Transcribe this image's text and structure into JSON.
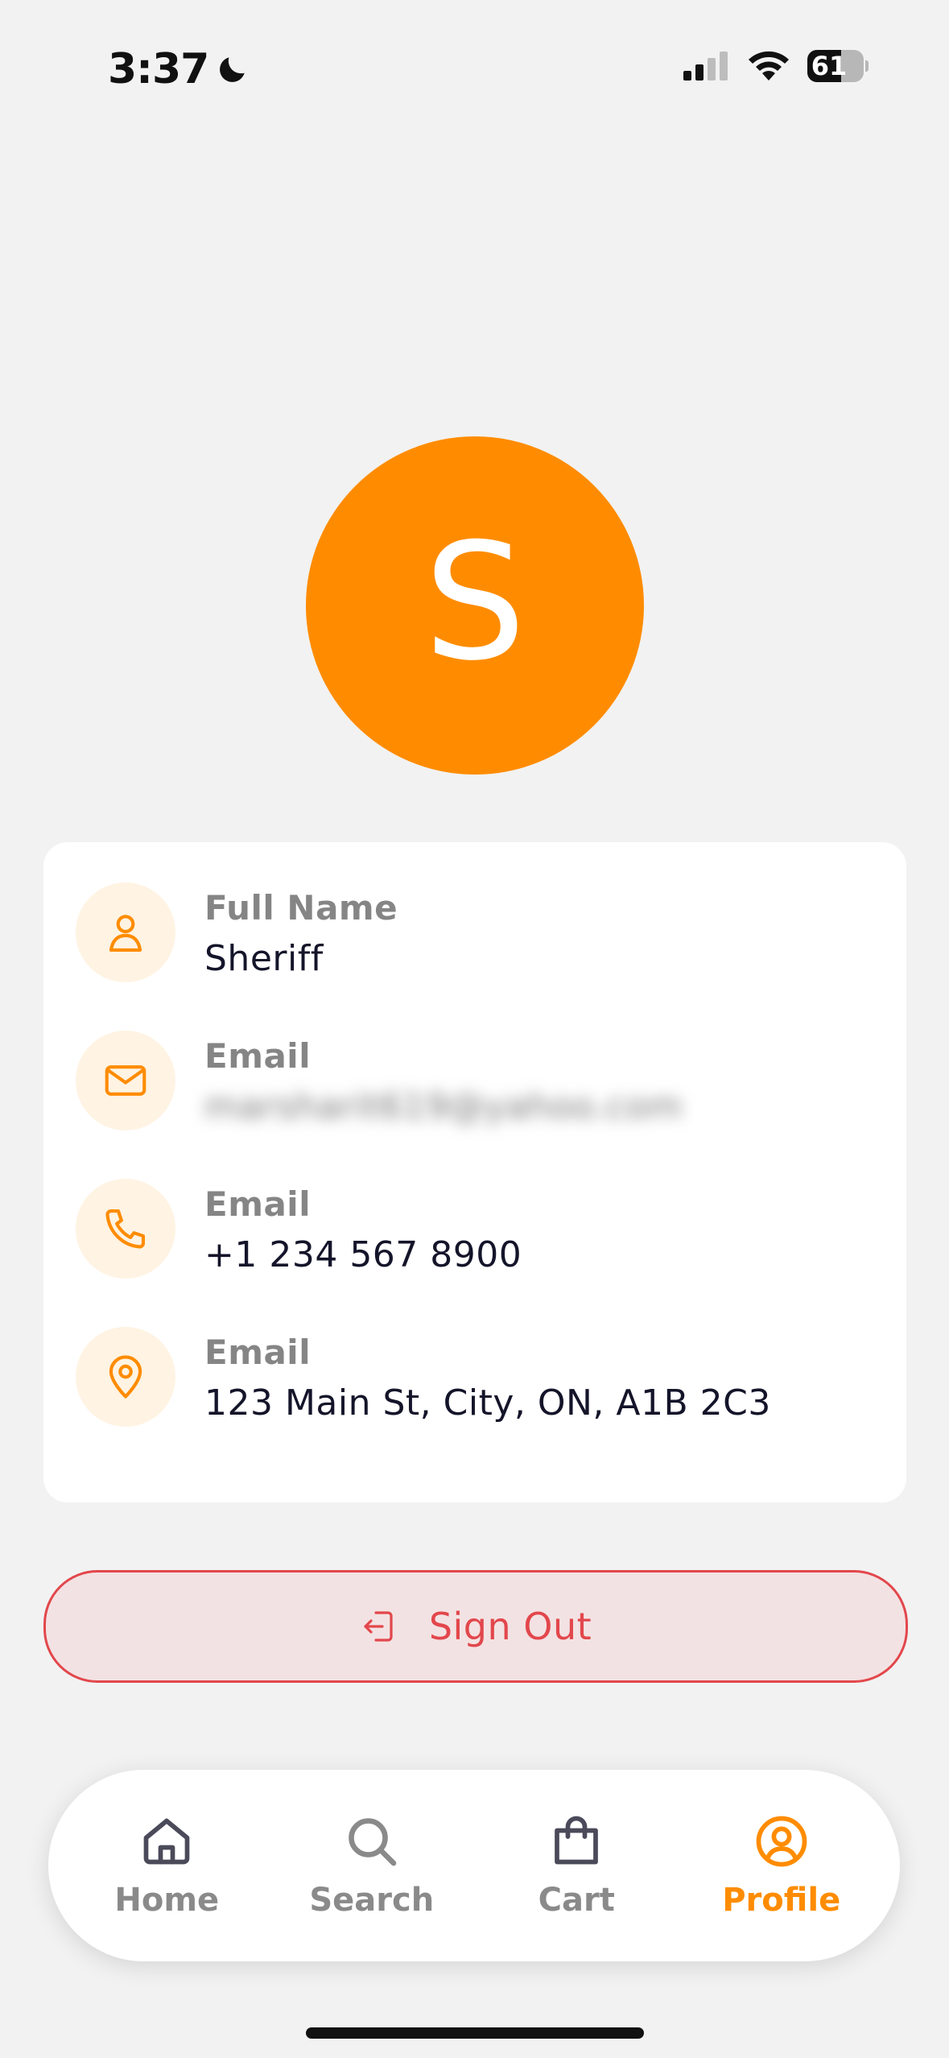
{
  "status_bar": {
    "time": "3:37",
    "battery": "61",
    "battery_level": 0.61
  },
  "avatar": {
    "initial": "S",
    "color": "#ff8c00"
  },
  "profile": {
    "rows": [
      {
        "label": "Full Name",
        "value": "Sheriff",
        "icon": "user-icon"
      },
      {
        "label": "Email",
        "value": "marsharit619@yahoo.com",
        "icon": "mail-icon",
        "blurred": true
      },
      {
        "label": "Email",
        "value": "+1 234 567 8900",
        "icon": "phone-icon"
      },
      {
        "label": "Email",
        "value": "123 Main St, City, ON, A1B 2C3",
        "icon": "location-pin-icon"
      }
    ]
  },
  "sign_out": {
    "label": "Sign Out",
    "icon": "sign-out-icon",
    "color": "#e2474c"
  },
  "tab_bar": {
    "items": [
      {
        "label": "Home",
        "icon": "home-icon",
        "active": false
      },
      {
        "label": "Search",
        "icon": "search-icon",
        "active": false
      },
      {
        "label": "Cart",
        "icon": "shopping-bag-icon",
        "active": false
      },
      {
        "label": "Profile",
        "icon": "profile-icon",
        "active": true
      }
    ],
    "active_color": "#ff8c00",
    "inactive_color": "#8a8a8a"
  }
}
